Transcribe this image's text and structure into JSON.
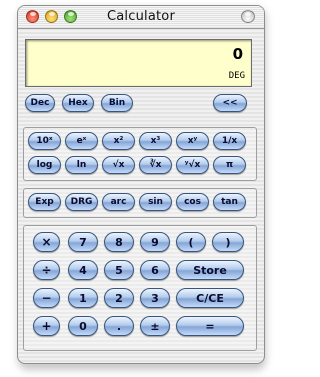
{
  "window": {
    "title": "Calculator"
  },
  "display": {
    "value": "0",
    "angle_mode": "DEG"
  },
  "modes": {
    "dec": "Dec",
    "hex": "Hex",
    "bin": "Bin",
    "back": "<<"
  },
  "sci_row1": [
    "10ˣ",
    "eˣ",
    "x²",
    "x³",
    "xʸ",
    "1/x"
  ],
  "sci_row2": [
    "log",
    "ln",
    "√x",
    "∛x",
    "ʸ√x",
    "π"
  ],
  "fn_row": [
    "Exp",
    "DRG",
    "arc",
    "sin",
    "cos",
    "tan"
  ],
  "keypad": {
    "row1": [
      "×",
      "7",
      "8",
      "9",
      "(",
      ")"
    ],
    "row2": [
      "÷",
      "4",
      "5",
      "6"
    ],
    "row2_store": "Store",
    "row3": [
      "−",
      "1",
      "2",
      "3"
    ],
    "row3_clear": "C/CE",
    "row4": [
      "+",
      "0",
      ".",
      "±"
    ],
    "equals": "="
  }
}
